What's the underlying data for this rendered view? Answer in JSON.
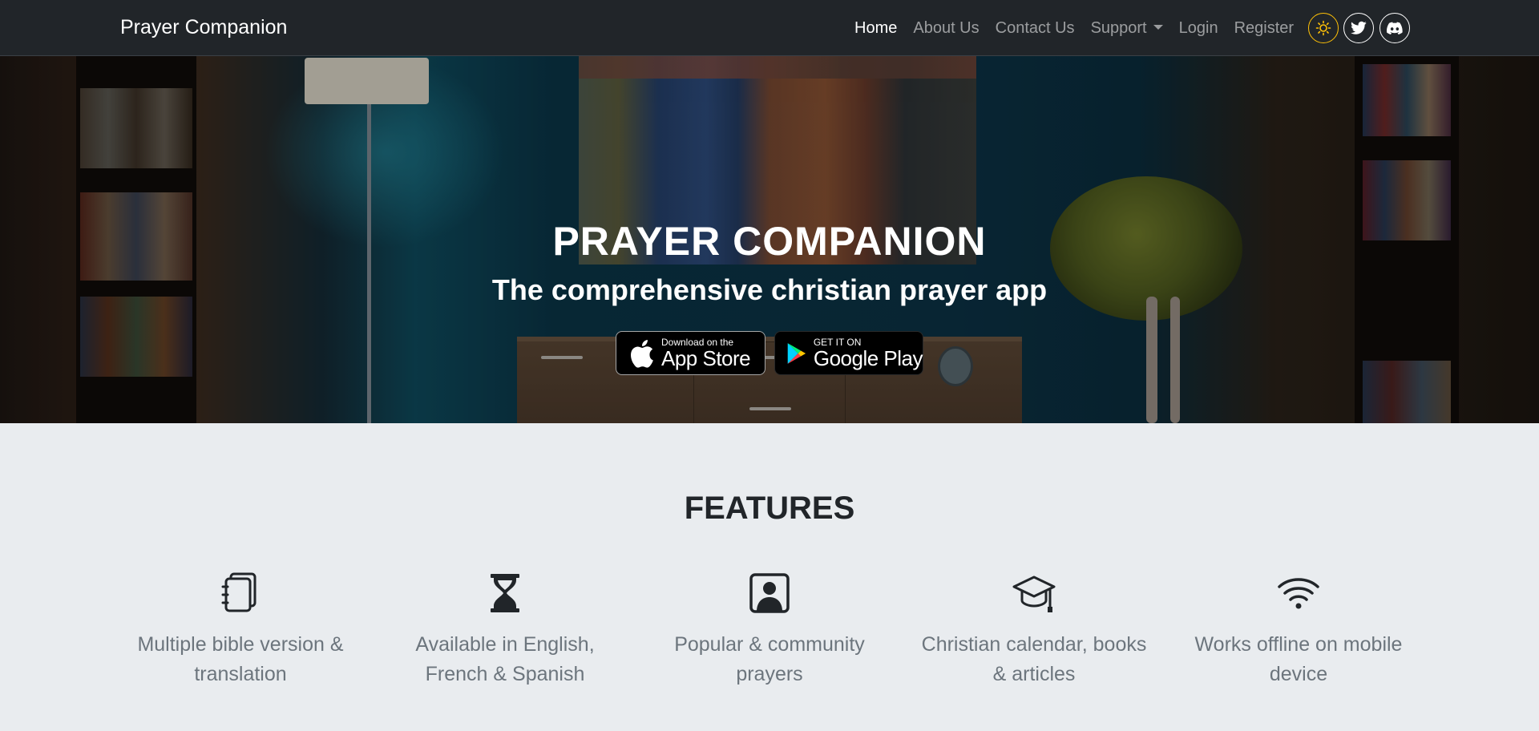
{
  "navbar": {
    "brand": "Prayer Companion",
    "links": [
      {
        "label": "Home",
        "active": true
      },
      {
        "label": "About Us",
        "active": false
      },
      {
        "label": "Contact Us",
        "active": false
      },
      {
        "label": "Support",
        "active": false,
        "dropdown": true
      },
      {
        "label": "Login",
        "active": false
      },
      {
        "label": "Register",
        "active": false
      }
    ],
    "icon_buttons": [
      {
        "icon": "sun-icon",
        "color": "#ffc107"
      },
      {
        "icon": "twitter-icon",
        "color": "#ffffff"
      },
      {
        "icon": "discord-icon",
        "color": "#ffffff"
      }
    ]
  },
  "hero": {
    "title": "PRAYER COMPANION",
    "subtitle": "The comprehensive christian prayer app",
    "app_store": {
      "small": "Download on the",
      "big": "App Store"
    },
    "google_play": {
      "small": "GET IT ON",
      "big": "Google Play"
    }
  },
  "features": {
    "title": "FEATURES",
    "items": [
      {
        "icon": "journals-icon",
        "text": "Multiple bible version & translation"
      },
      {
        "icon": "hourglass-icon",
        "text": "Available in English, French & Spanish"
      },
      {
        "icon": "person-square-icon",
        "text": "Popular & community prayers"
      },
      {
        "icon": "mortarboard-icon",
        "text": "Christian calendar, books & articles"
      },
      {
        "icon": "wifi-icon",
        "text": "Works offline on mobile device"
      }
    ]
  },
  "colors": {
    "navbar_bg": "#212529",
    "page_bg": "#e9ecef",
    "accent_yellow": "#ffc107",
    "muted_text": "#6c757d"
  }
}
